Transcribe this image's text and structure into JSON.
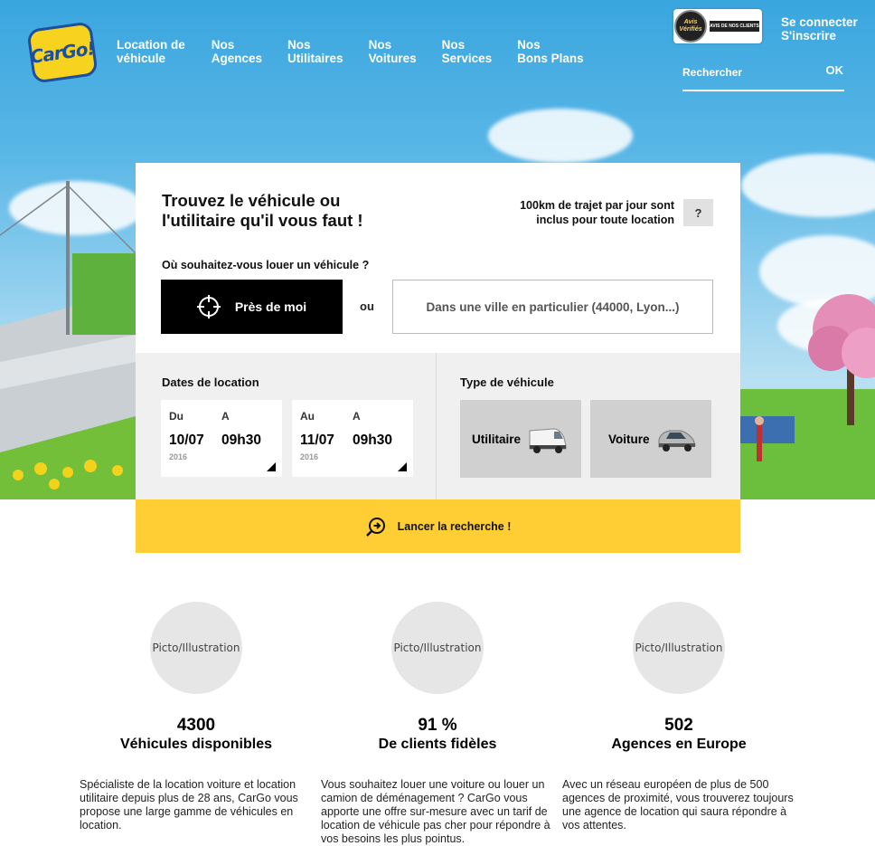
{
  "header": {
    "logo_text": "CarGo!",
    "nav": [
      {
        "l1": "Location de",
        "l2": "véhicule"
      },
      {
        "l1": "Nos",
        "l2": "Agences"
      },
      {
        "l1": "Nos",
        "l2": "Utilitaires"
      },
      {
        "l1": "Nos",
        "l2": "Voitures"
      },
      {
        "l1": "Nos",
        "l2": "Services"
      },
      {
        "l1": "Nos",
        "l2": "Bons Plans"
      }
    ],
    "reviews_badge": {
      "seal_l1": "Avis",
      "seal_l2": "Vérifiés",
      "bar_text": "AVIS DE NOS CLIENTS"
    },
    "login": "Se connecter",
    "register": "S'inscrire",
    "search_placeholder": "Rechercher",
    "search_ok": "OK"
  },
  "card": {
    "title": "Trouvez le véhicule ou l'utilitaire qu'il vous faut !",
    "km_note": "100km de trajet par jour sont inclus pour toute location",
    "help": "?",
    "question": "Où souhaitez-vous louer un véhicule ?",
    "near_me": "Près de moi",
    "or": "ou",
    "city_placeholder": "Dans une ville en particulier (44000, Lyon...)",
    "dates_label": "Dates de location",
    "from": {
      "day_label": "Du",
      "time_label": "A",
      "date": "10/07",
      "time": "09h30",
      "year": "2016"
    },
    "to": {
      "day_label": "Au",
      "time_label": "A",
      "date": "11/07",
      "time": "09h30",
      "year": "2016"
    },
    "vehicle_type_label": "Type de véhicule",
    "vehicle_types": [
      "Utilitaire",
      "Voiture"
    ],
    "launch": "Lancer la recherche !"
  },
  "stats": [
    {
      "picto": "Picto/Illustration",
      "value": "4300",
      "label": "Véhicules disponibles",
      "description": "Spécialiste de la location voiture et location utilitaire depuis plus de 28 ans, CarGo vous propose une large gamme de véhicules en location."
    },
    {
      "picto": "Picto/Illustration",
      "value": "91 %",
      "label": "De clients fidèles",
      "description": "Vous souhaitez louer une voiture ou louer un camion de déménagement ? CarGo vous apporte une offre sur-mesure avec un tarif de location de véhicule pas cher pour répondre à vos besoins les plus pointus."
    },
    {
      "picto": "Picto/Illustration",
      "value": "502",
      "label": "Agences en Europe",
      "description": "Avec un réseau européen de plus de 500 agences de proximité, vous trouverez toujours une agence de location qui saura répondre à vos attentes."
    }
  ],
  "colors": {
    "accent": "#ffcd34",
    "sky": "#58b6e6",
    "dark": "#000000",
    "grey_panel": "#f0f0f0"
  }
}
